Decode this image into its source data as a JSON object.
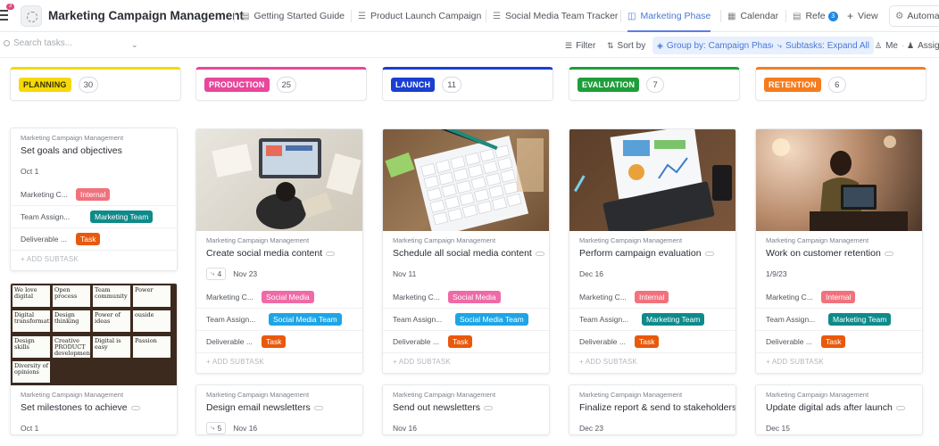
{
  "header": {
    "notification_count": "3",
    "title": "Marketing Campaign Management",
    "tabs": [
      {
        "label": "Getting Started Guide",
        "icon": "doc-icon"
      },
      {
        "label": "Product Launch Campaign",
        "icon": "list-icon"
      },
      {
        "label": "Social Media Team Tracker",
        "icon": "list-icon"
      },
      {
        "label": "Marketing Phase",
        "icon": "board-icon",
        "active": true
      },
      {
        "label": "Calendar",
        "icon": "calendar-icon"
      },
      {
        "label": "Refe",
        "icon": "doc-icon"
      }
    ],
    "more_badge": "3",
    "add_view": "View",
    "automations": "Automa"
  },
  "toolbar": {
    "search_placeholder": "Search tasks...",
    "filter": "Filter",
    "sort": "Sort by",
    "group": "Group by: Campaign Phase",
    "subtasks": "Subtasks: Expand All",
    "me": "Me",
    "assignees": "Assig"
  },
  "colors": {
    "planning": "#f5d90a",
    "production": "#e8479b",
    "launch": "#1a3fd1",
    "evaluation": "#1e9e3a",
    "retention": "#f57c1f",
    "internal": "#f0727d",
    "social_media": "#ef6aa6",
    "team_teal": "#0f8a8a",
    "team_blue": "#1ea5e6",
    "task": "#e8590c"
  },
  "columns": [
    {
      "phase": "PLANNING",
      "count": "30",
      "cards": [
        {
          "crumb": "Marketing Campaign Management",
          "title": "Set goals and objectives",
          "date": "Oct 1",
          "rows": [
            {
              "label": "Marketing C...",
              "pill": "Internal"
            },
            {
              "label": "Team Assign...",
              "pill": "Marketing Team"
            },
            {
              "label": "Deliverable ...",
              "pill": "Task"
            }
          ],
          "add": "+ ADD SUBTASK"
        },
        {
          "crumb": "Marketing Campaign Management",
          "title": "Set milestones to achieve",
          "date": "Oct 1",
          "image": "sticky-notes-image",
          "notes": [
            "We love digital",
            "Open process",
            "Team community",
            "Power",
            "Digital transformation",
            "Design thinking",
            "Power of ideas",
            "ouside",
            "Design skills",
            "Creative PRODUCT development",
            "Digital is easy",
            "Passion",
            "Diversity of opinions"
          ]
        }
      ]
    },
    {
      "phase": "PRODUCTION",
      "count": "25",
      "cards": [
        {
          "crumb": "Marketing Campaign Management",
          "title": "Create social media content",
          "subtasks": "4",
          "date": "Nov 23",
          "image": "desk-photo-image",
          "rows": [
            {
              "label": "Marketing C...",
              "pill": "Social Media"
            },
            {
              "label": "Team Assign...",
              "pill": "Social Media Team"
            },
            {
              "label": "Deliverable ...",
              "pill": "Task"
            }
          ],
          "add": "+ ADD SUBTASK"
        },
        {
          "crumb": "Marketing Campaign Management",
          "title": "Design email newsletters",
          "subtasks": "5",
          "date": "Nov 16"
        }
      ]
    },
    {
      "phase": "LAUNCH",
      "count": "11",
      "cards": [
        {
          "crumb": "Marketing Campaign Management",
          "title": "Schedule all social media content",
          "date": "Nov 11",
          "image": "calendar-photo-image",
          "rows": [
            {
              "label": "Marketing C...",
              "pill": "Social Media"
            },
            {
              "label": "Team Assign...",
              "pill": "Social Media Team"
            },
            {
              "label": "Deliverable ...",
              "pill": "Task"
            }
          ],
          "add": "+ ADD SUBTASK"
        },
        {
          "crumb": "Marketing Campaign Management",
          "title": "Send out newsletters",
          "date": "Nov 16"
        }
      ]
    },
    {
      "phase": "EVALUATION",
      "count": "7",
      "cards": [
        {
          "crumb": "Marketing Campaign Management",
          "title": "Perform campaign evaluation",
          "date": "Dec 16",
          "image": "report-photo-image",
          "rows": [
            {
              "label": "Marketing C...",
              "pill": "Internal"
            },
            {
              "label": "Team Assign...",
              "pill": "Marketing Team"
            },
            {
              "label": "Deliverable ...",
              "pill": "Task"
            }
          ],
          "add": "+ ADD SUBTASK"
        },
        {
          "crumb": "Marketing Campaign Management",
          "title": "Finalize report & send to stakeholders",
          "date": "Dec 23"
        }
      ]
    },
    {
      "phase": "RETENTION",
      "count": "6",
      "cards": [
        {
          "crumb": "Marketing Campaign Management",
          "title": "Work on customer retention",
          "date": "1/9/23",
          "image": "shop-photo-image",
          "rows": [
            {
              "label": "Marketing C...",
              "pill": "Internal"
            },
            {
              "label": "Team Assign...",
              "pill": "Marketing Team"
            },
            {
              "label": "Deliverable ...",
              "pill": "Task"
            }
          ],
          "add": "+ ADD SUBTASK"
        },
        {
          "crumb": "Marketing Campaign Management",
          "title": "Update digital ads after launch",
          "date": "Dec 15"
        }
      ]
    }
  ]
}
